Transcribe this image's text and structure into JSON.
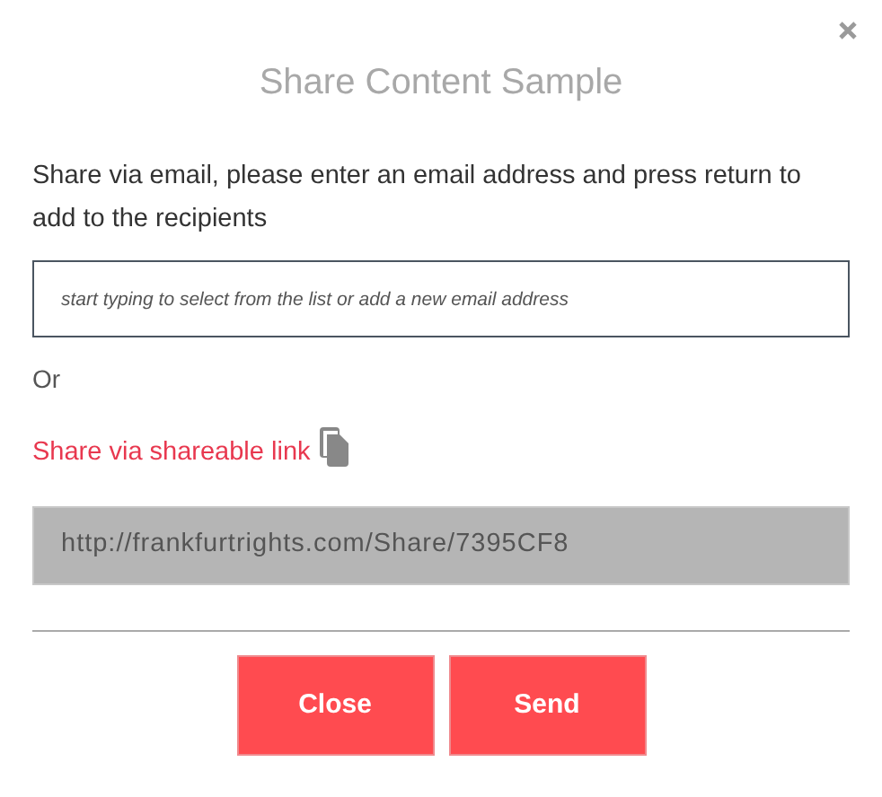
{
  "dialog": {
    "title": "Share Content Sample"
  },
  "instructions": "Share via email, please enter an email address and press return to add to the recipients",
  "email_field": {
    "placeholder": "start typing to select from the list or add a new email address"
  },
  "separator_text": "Or",
  "share_link": {
    "label": "Share via shareable link",
    "url": "http://frankfurtrights.com/Share/7395CF8"
  },
  "buttons": [
    {
      "label": "Close"
    },
    {
      "label": "Send"
    }
  ]
}
